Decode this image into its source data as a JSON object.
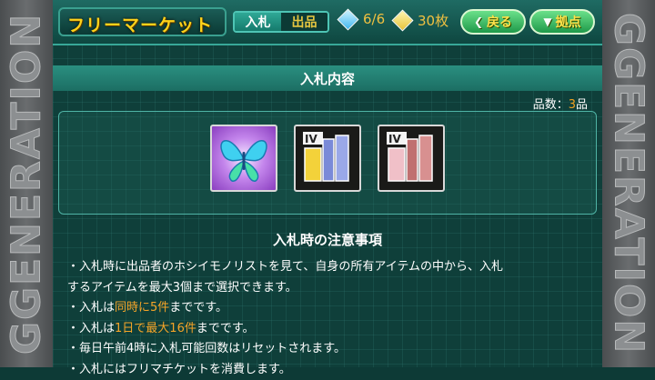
{
  "side_logo": "GGENERATION",
  "header": {
    "title": "フリーマーケット",
    "tabs": [
      {
        "label": "入札",
        "active": true
      },
      {
        "label": "出品",
        "active": false
      }
    ],
    "bid_count": "6/6",
    "tickets": "30枚",
    "back_label": "戻る",
    "base_label": "拠点"
  },
  "section": {
    "title": "入札内容",
    "count_label": "品数：",
    "count_value": "3",
    "count_unit": "品"
  },
  "items": [
    {
      "icon": "butterfly-icon"
    },
    {
      "icon": "book-set-blue-icon"
    },
    {
      "icon": "book-set-red-icon"
    }
  ],
  "notes": {
    "title": "入札時の注意事項",
    "line1": "・入札時に出品者のホシイモノリストを見て、自身の所有アイテムの中から、入札",
    "line2": "するアイテムを最大3個まで選択できます。",
    "line3_a": "・入札は",
    "line3_hl": "同時に5件",
    "line3_b": "までです。",
    "line4_a": "・入札は",
    "line4_hl1": "1日で",
    "line4_hl2": "最大16件",
    "line4_b": "までです。",
    "line5": "・毎日午前4時に入札可能回数はリセットされます。",
    "line6": "・入札にはフリマチケットを消費します。"
  },
  "colors": {
    "accent_orange": "#f5a428",
    "title_yellow": "#ffd21a",
    "teal_bar": "#2a8f80"
  }
}
